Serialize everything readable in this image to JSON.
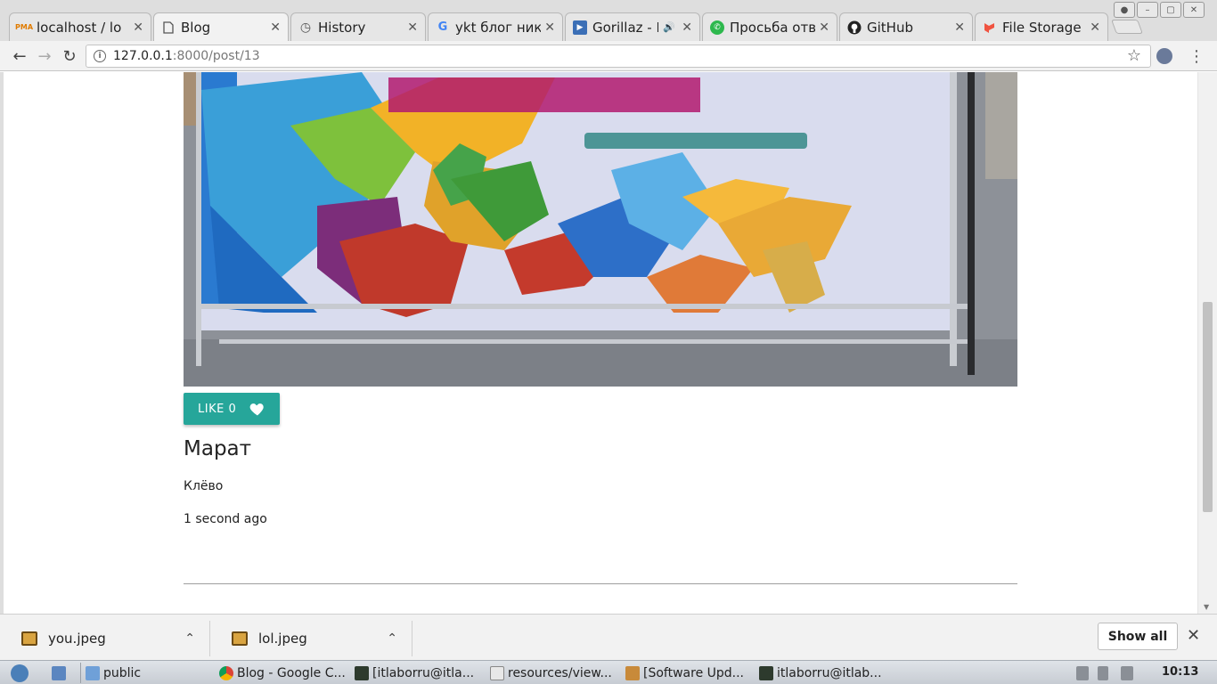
{
  "browser": {
    "tabs": [
      {
        "title": "localhost / lo",
        "favicon": "phpmyadmin-icon"
      },
      {
        "title": "Blog",
        "favicon": "page-icon",
        "active": true
      },
      {
        "title": "History",
        "favicon": "history-icon"
      },
      {
        "title": "ykt блог нико",
        "favicon": "google-icon"
      },
      {
        "title": "Gorillaz - D",
        "favicon": "play-icon"
      },
      {
        "title": "Просьба отве",
        "favicon": "chat-icon"
      },
      {
        "title": "GitHub",
        "favicon": "github-icon"
      },
      {
        "title": "File Storage -",
        "favicon": "laravel-icon"
      }
    ],
    "close_glyph": "✕",
    "url_host": "127.0.0.1",
    "url_path": ":8000/post/13",
    "info_glyph": "i",
    "back_glyph": "←",
    "forward_glyph": "→",
    "reload_glyph": "↻",
    "star_glyph": "☆",
    "menu_glyph": "⋮"
  },
  "post": {
    "like_label": "LIKE 0",
    "author": "Марат",
    "comment": "Клёво",
    "time": "1 second ago"
  },
  "downloads": {
    "items": [
      {
        "name": "you.jpeg"
      },
      {
        "name": "lol.jpeg"
      }
    ],
    "chevron": "⌃",
    "show_all": "Show all",
    "close_glyph": "✕"
  },
  "taskbar": {
    "items": [
      {
        "label": "public"
      },
      {
        "label": "Blog - Google C..."
      },
      {
        "label": "[itlaborru@itla..."
      },
      {
        "label": "resources/view..."
      },
      {
        "label": "[Software Upd..."
      },
      {
        "label": "itlaborru@itlab..."
      }
    ],
    "clock": "10:13"
  },
  "colors": {
    "accent": "#26a69a"
  }
}
